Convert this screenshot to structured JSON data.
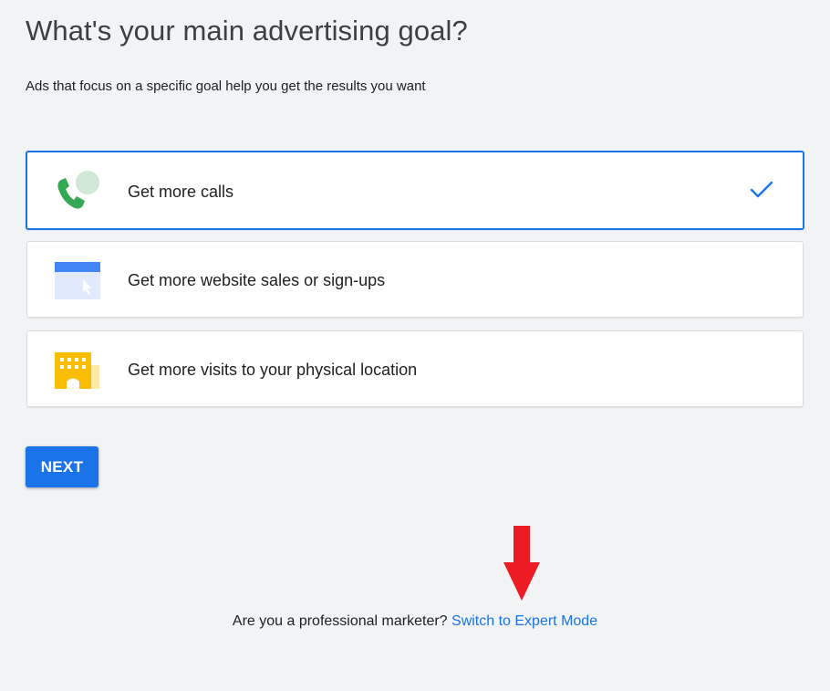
{
  "header": {
    "title": "What's your main advertising goal?",
    "subtitle": "Ads that focus on a specific goal help you get the results you want"
  },
  "goals": [
    {
      "label": "Get more calls",
      "icon": "phone-call-icon",
      "selected": true
    },
    {
      "label": "Get more website sales or sign-ups",
      "icon": "website-cursor-icon",
      "selected": false
    },
    {
      "label": "Get more visits to your physical location",
      "icon": "building-icon",
      "selected": false
    }
  ],
  "actions": {
    "next_label": "NEXT"
  },
  "footer": {
    "question": "Are you a professional marketer?",
    "link_label": "Switch to Expert Mode"
  },
  "colors": {
    "accent": "#1a73e8",
    "background": "#f1f3f4",
    "annotation_arrow": "#ed1c24"
  }
}
